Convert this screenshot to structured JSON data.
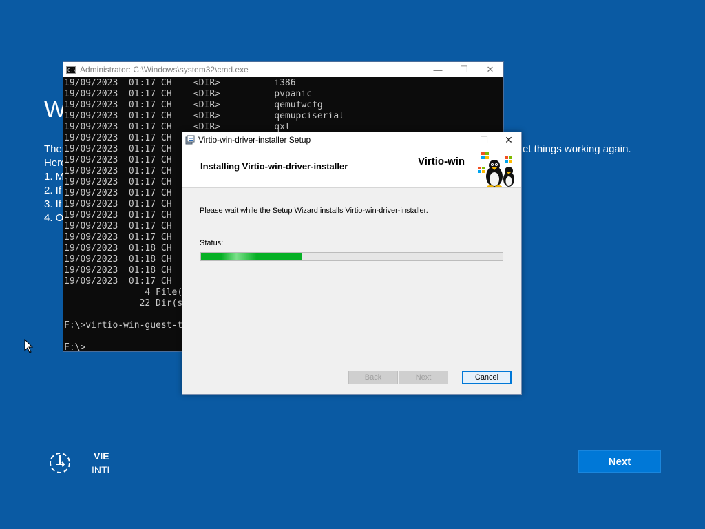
{
  "background": {
    "title_partial": "W",
    "lines": [
      "Ther",
      "Here",
      "1. M",
      "2. If",
      "3. If",
      "4. O"
    ],
    "right_text": "et things working again."
  },
  "cmd": {
    "title": "Administrator: C:\\Windows\\system32\\cmd.exe",
    "icon": "console-icon",
    "lines": [
      "19/09/2023  01:17 CH    <DIR>          i386",
      "19/09/2023  01:17 CH    <DIR>          pvpanic",
      "19/09/2023  01:17 CH    <DIR>          qemufwcfg",
      "19/09/2023  01:17 CH    <DIR>          qemupciserial",
      "19/09/2023  01:17 CH    <DIR>          qxl",
      "19/09/2023  01:17 CH",
      "19/09/2023  01:17 CH",
      "19/09/2023  01:17 CH",
      "19/09/2023  01:17 CH",
      "19/09/2023  01:17 CH",
      "19/09/2023  01:17 CH",
      "19/09/2023  01:17 CH",
      "19/09/2023  01:17 CH",
      "19/09/2023  01:17 CH",
      "19/09/2023  01:17 CH",
      "19/09/2023  01:18 CH",
      "19/09/2023  01:18 CH",
      "19/09/2023  01:18 CH",
      "19/09/2023  01:17 CH",
      "               4 File(",
      "              22 Dir(s",
      "",
      "F:\\>virtio-win-guest-t",
      "",
      "F:\\>"
    ]
  },
  "installer": {
    "title": "Virtio-win-driver-installer Setup",
    "heading": "Installing Virtio-win-driver-installer",
    "brand": "Virtio-win",
    "message": "Please wait while the Setup Wizard installs Virtio-win-driver-installer.",
    "status_label": "Status:",
    "progress_fraction": 0.335,
    "buttons": {
      "back": "Back",
      "next": "Next",
      "cancel": "Cancel"
    }
  },
  "oobe": {
    "language_code": "VIE",
    "keyboard_layout": "INTL",
    "next_label": "Next",
    "accessibility_icon": "accessibility-icon"
  },
  "colors": {
    "desktop_bg": "#0a5aa3",
    "progress_green": "#06b025",
    "accent_blue": "#0078d7"
  }
}
